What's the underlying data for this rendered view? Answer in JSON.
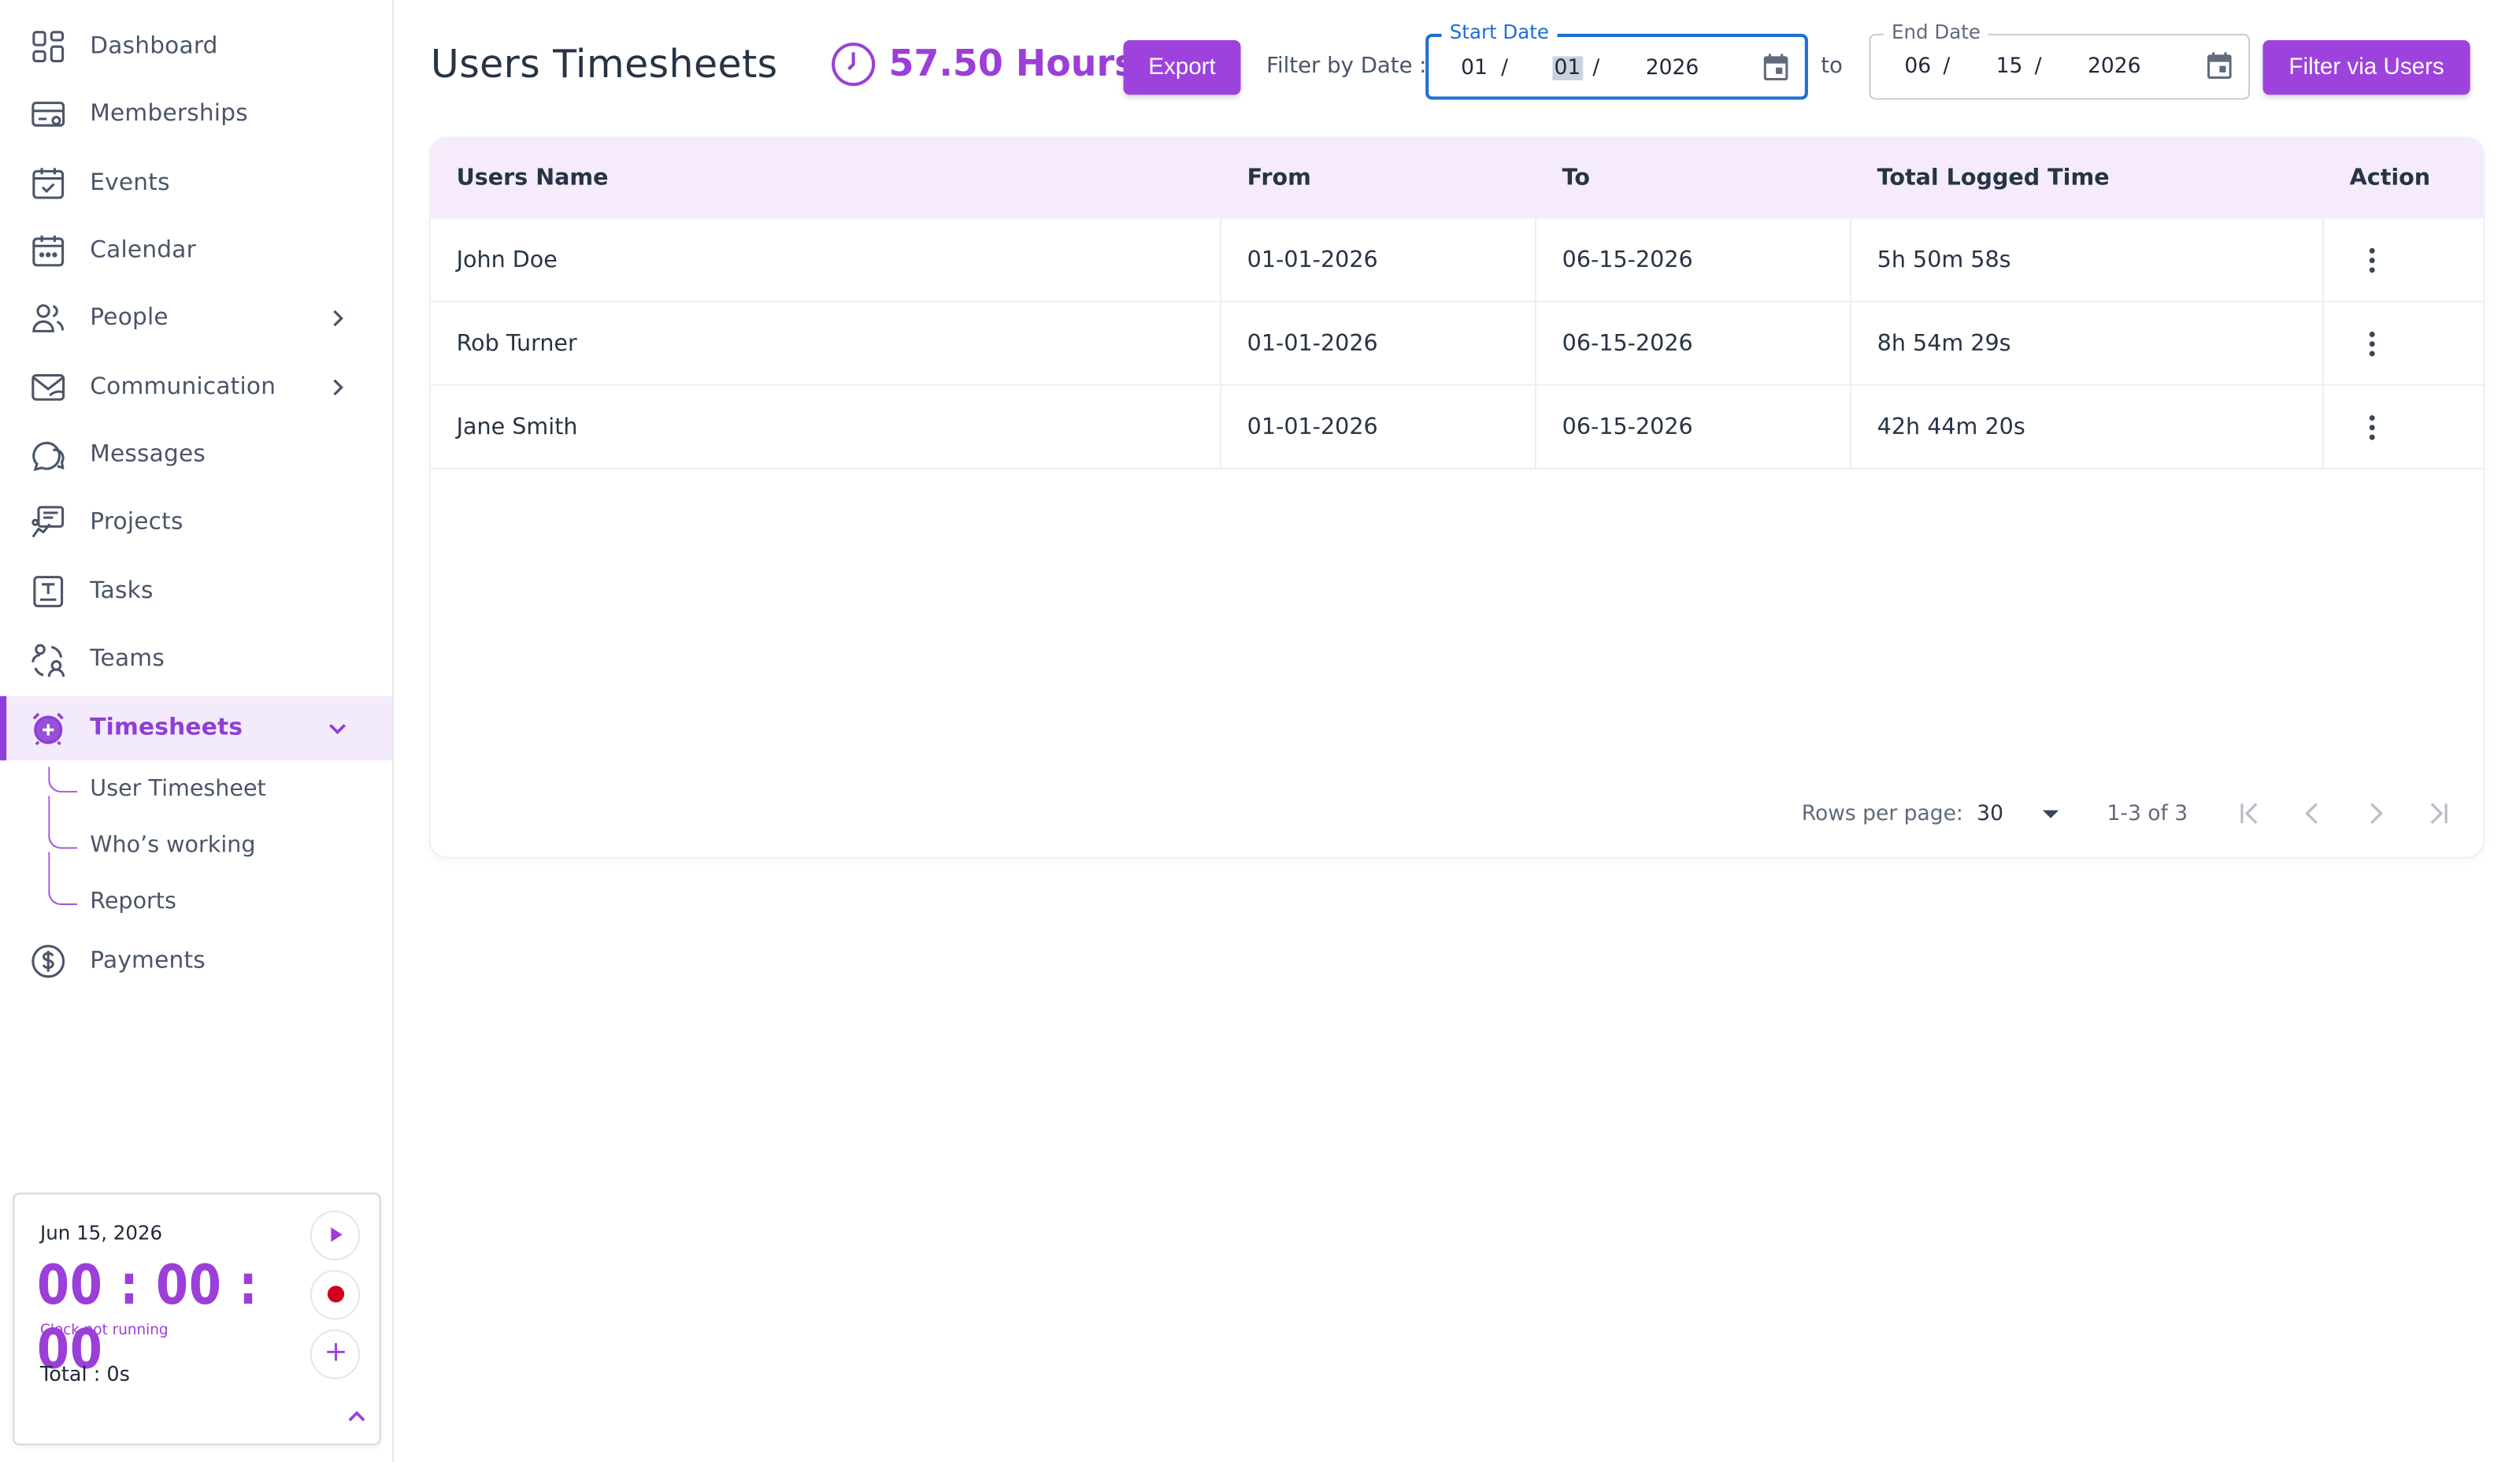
{
  "sidebar": {
    "items": [
      {
        "label": "Dashboard",
        "icon": "dashboard-icon"
      },
      {
        "label": "Memberships",
        "icon": "membership-card-icon"
      },
      {
        "label": "Events",
        "icon": "calendar-check-icon"
      },
      {
        "label": "Calendar",
        "icon": "calendar-icon"
      },
      {
        "label": "People",
        "icon": "people-icon"
      },
      {
        "label": "Communication",
        "icon": "envelope-icon"
      },
      {
        "label": "Messages",
        "icon": "chat-bubbles-icon"
      },
      {
        "label": "Projects",
        "icon": "projects-icon"
      },
      {
        "label": "Tasks",
        "icon": "task-icon"
      },
      {
        "label": "Teams",
        "icon": "teams-icon"
      },
      {
        "label": "Timesheets",
        "icon": "alarm-clock-icon"
      },
      {
        "label": "Payments",
        "icon": "dollar-circle-icon"
      }
    ],
    "sub_items": [
      "User Timesheet",
      "Who’s working",
      "Reports"
    ],
    "active": "Timesheets"
  },
  "timer": {
    "date": "Jun 15, 2026",
    "clock": "00 : 00 : 00",
    "status": "Clock not running",
    "total": "Total : 0s"
  },
  "header": {
    "title": "Users Timesheets",
    "hours": "57.50 Hours",
    "export_label": "Export",
    "filter_label": "Filter by Date :",
    "to_label": "to",
    "filter_users_label": "Filter via Users",
    "start_date": {
      "legend": "Start Date",
      "month": "01",
      "day": "01",
      "year": "2026",
      "sep": "/"
    },
    "end_date": {
      "legend": "End Date",
      "month": "06",
      "day": "15",
      "year": "2026",
      "sep": "/"
    }
  },
  "table": {
    "columns": [
      "Users Name",
      "From",
      "To",
      "Total Logged Time",
      "Action"
    ],
    "rows": [
      {
        "name": "John Doe",
        "from": "01-01-2026",
        "to": "06-15-2026",
        "total": "5h 50m 58s"
      },
      {
        "name": "Rob Turner",
        "from": "01-01-2026",
        "to": "06-15-2026",
        "total": "8h 54m 29s"
      },
      {
        "name": "Jane Smith",
        "from": "01-01-2026",
        "to": "06-15-2026",
        "total": "42h 44m 20s"
      }
    ]
  },
  "pagination": {
    "rows_per_page_label": "Rows per page:",
    "rows_per_page": "30",
    "range": "1-3 of 3"
  },
  "colors": {
    "accent": "#9e42dd",
    "active_bg": "#f3eafb",
    "header_bg": "#f5ebfb",
    "focus_blue": "#1f6fd1",
    "record_red": "#d0021b"
  }
}
